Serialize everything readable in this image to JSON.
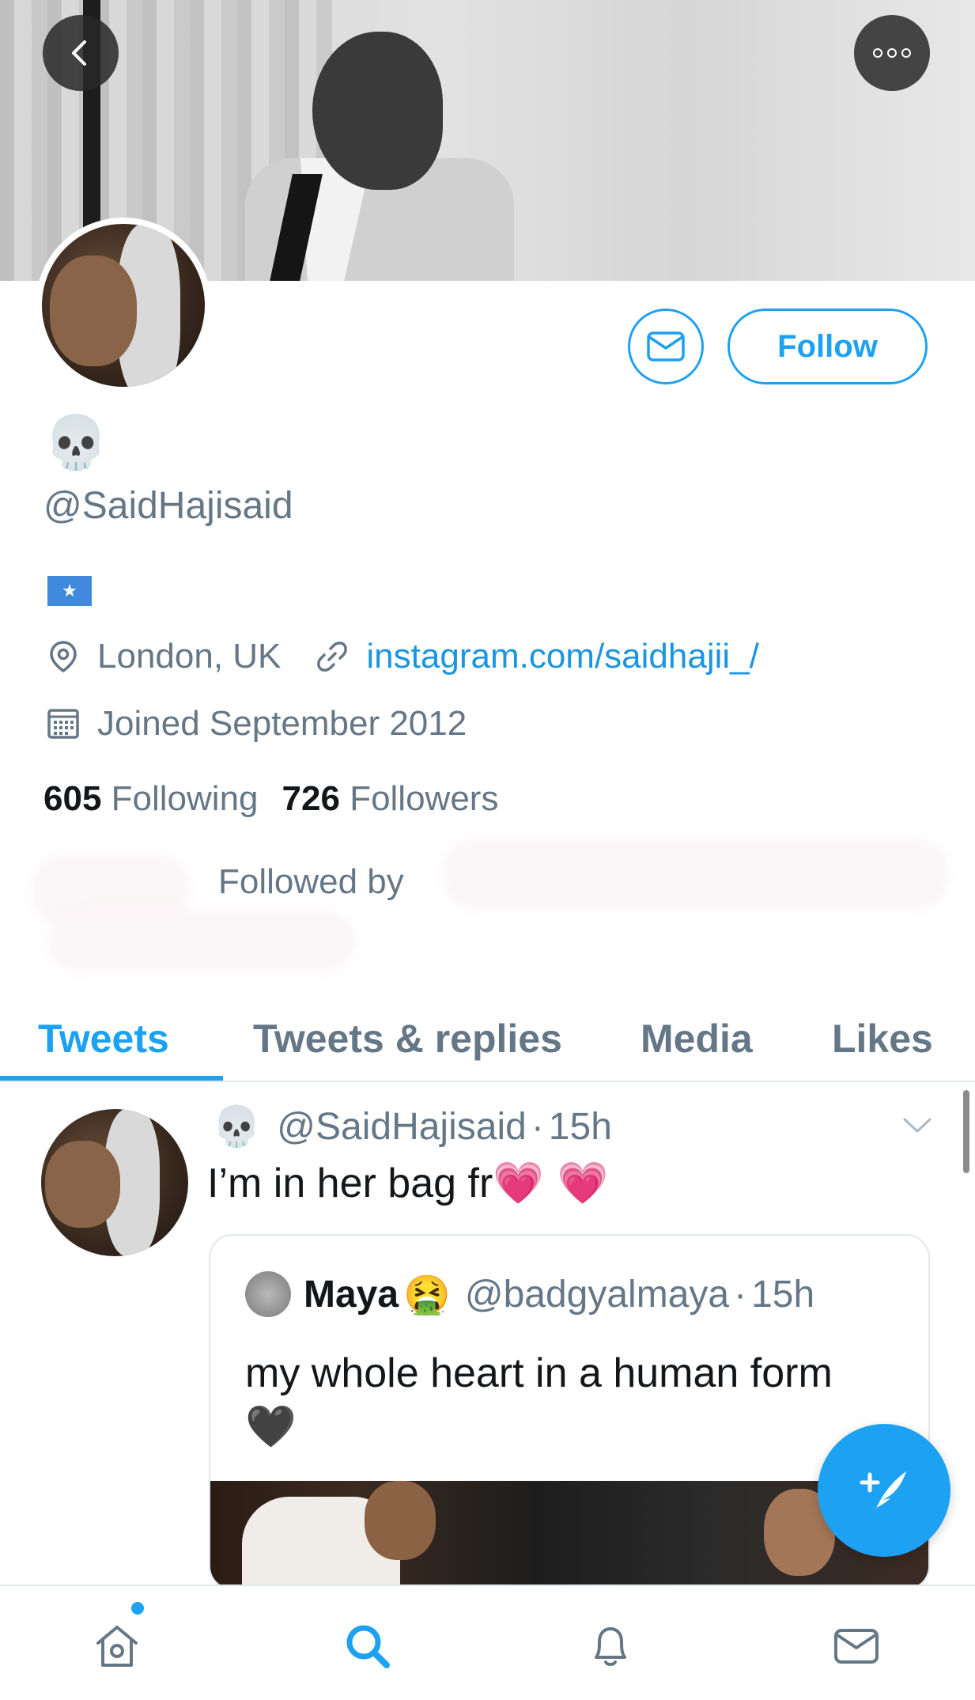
{
  "profile": {
    "display_name": "💀",
    "handle": "@SaidHajisaid",
    "bio_flag": "★",
    "location": "London, UK",
    "website": "instagram.com/saidhajii_/",
    "joined": "Joined September 2012",
    "following_count": "605",
    "following_label": "Following",
    "followers_count": "726",
    "followers_label": "Followers",
    "followed_by": "Followed by"
  },
  "actions": {
    "follow_label": "Follow",
    "message_icon": "mail-icon",
    "back_icon": "back-chevron-icon",
    "more_icon": "more-options-icon"
  },
  "tabs": [
    {
      "label": "Tweets",
      "active": true
    },
    {
      "label": "Tweets & replies",
      "active": false
    },
    {
      "label": "Media",
      "active": false
    },
    {
      "label": "Likes",
      "active": false
    }
  ],
  "tweet": {
    "author_emoji": "💀",
    "handle": "@SaidHajisaid",
    "separator": "·",
    "time": "15h",
    "text": "I’m in her bag fr",
    "text_emoji": "💗 💗",
    "quote": {
      "name": "Maya",
      "name_emoji": "🤮",
      "handle": "@badgyalmaya",
      "separator": "·",
      "time": "15h",
      "text": "my whole heart in a human form",
      "text_emoji": "🖤"
    }
  },
  "nav": [
    {
      "icon": "home-icon",
      "active": false,
      "badge": true
    },
    {
      "icon": "search-icon",
      "active": true
    },
    {
      "icon": "notifications-bell-icon",
      "active": false
    },
    {
      "icon": "messages-mail-icon",
      "active": false
    }
  ],
  "colors": {
    "accent": "#1da1f2",
    "link": "#1b95e0",
    "secondary_text": "#657786",
    "primary_text": "#14171a",
    "divider": "#e1e8ed"
  }
}
